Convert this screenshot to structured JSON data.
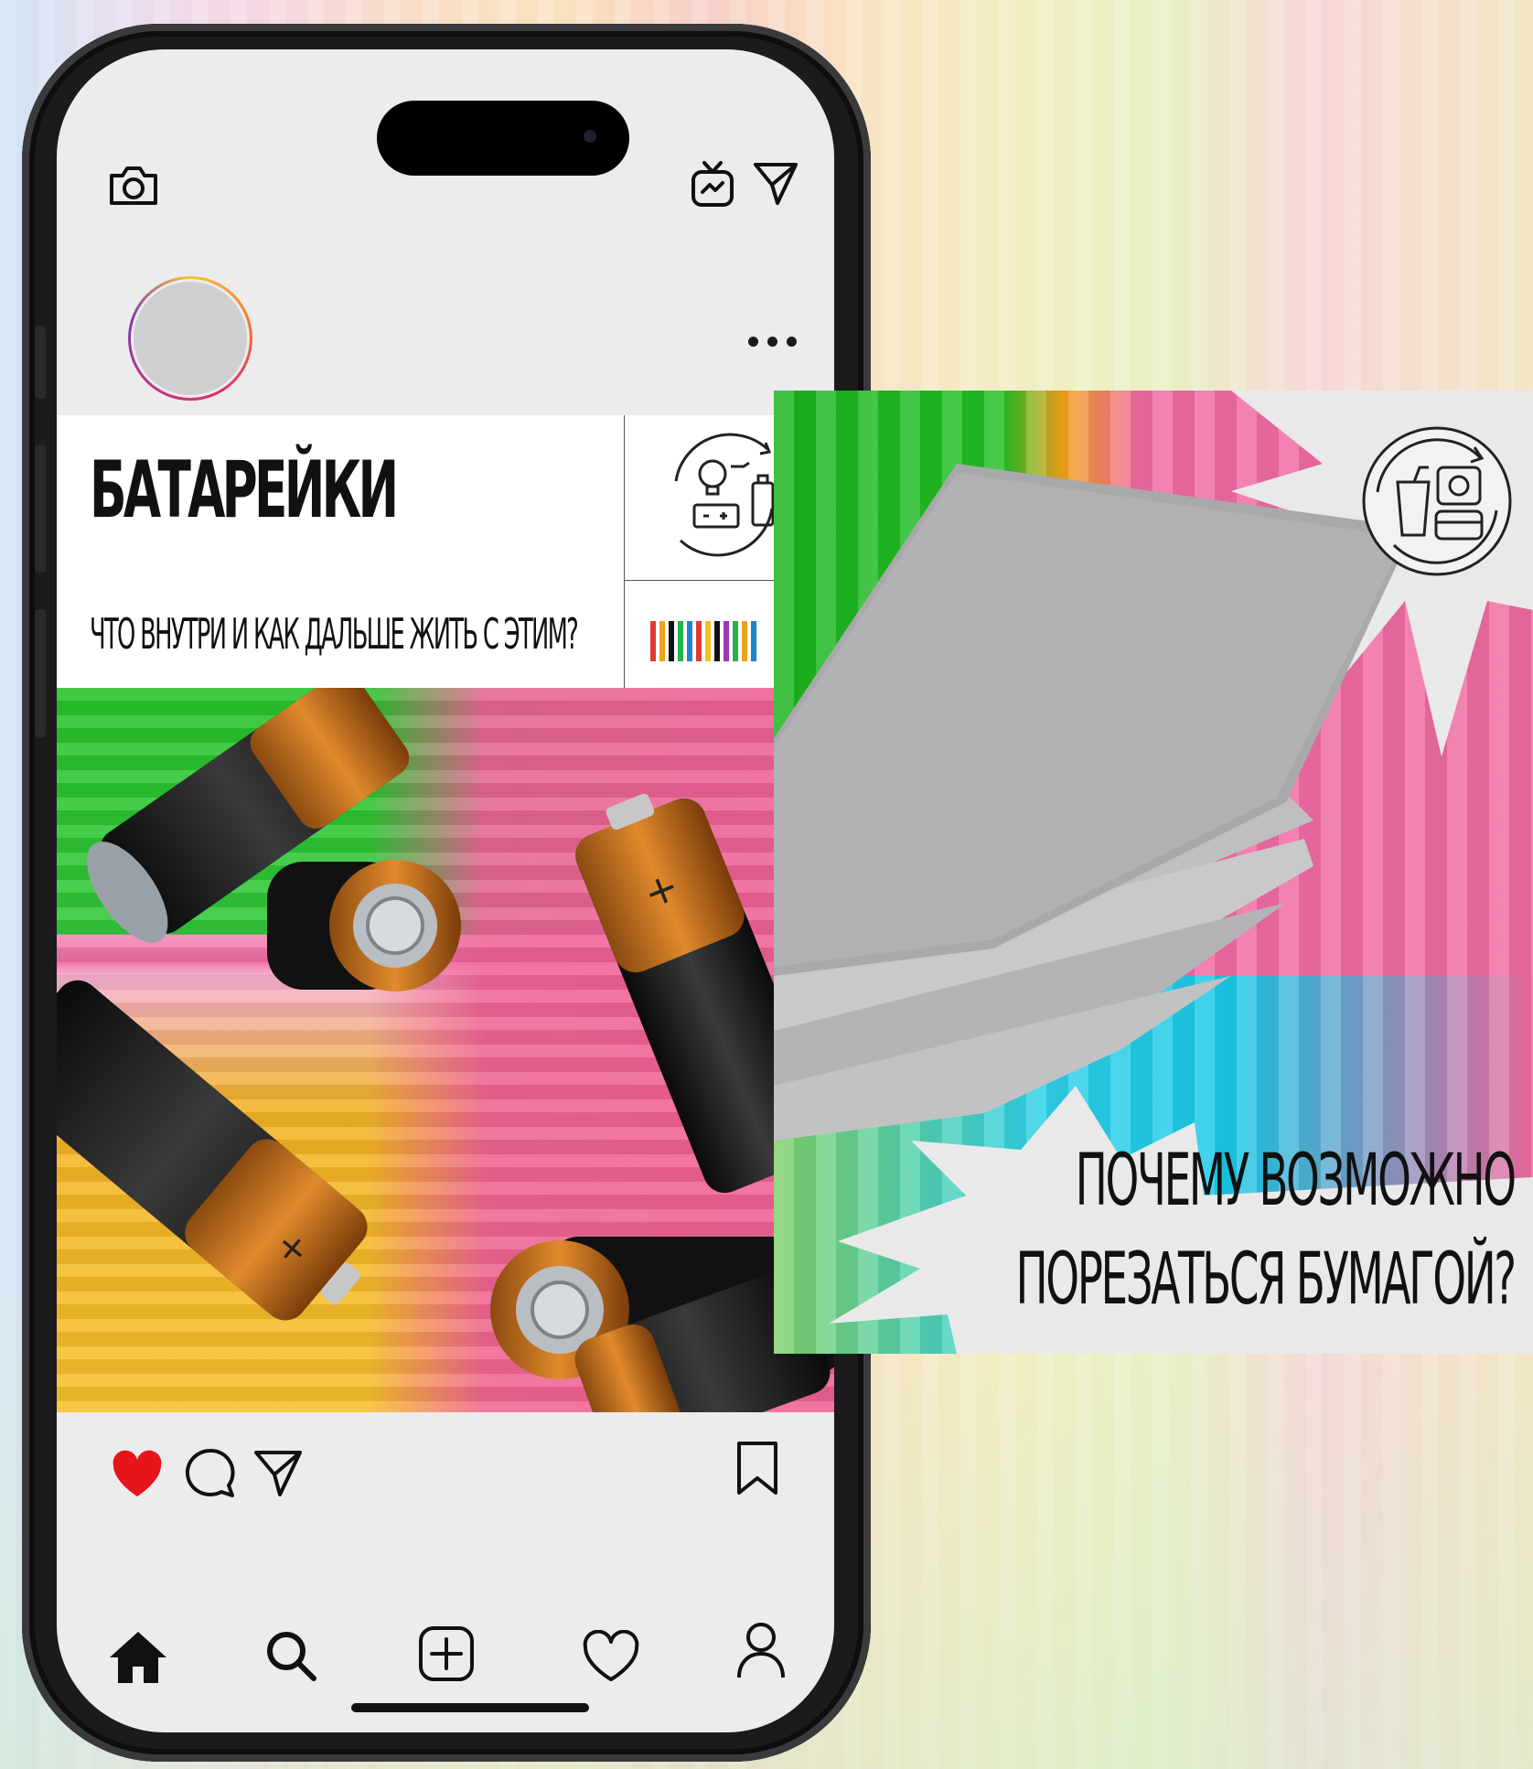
{
  "post": {
    "title": "БАТАРЕЙКИ",
    "subtitle": "ЧТО ВНУТРИ И КАК ДАЛЬШЕ ЖИТЬ С ЭТИМ?"
  },
  "overlay_card": {
    "headline_line1": "ПОЧЕМУ ВОЗМОЖНО",
    "headline_line2": "ПОРЕЗАТЬСЯ БУМАГОЙ?"
  },
  "icons": {
    "top_left": "camera-icon",
    "top_right": [
      "igtv-icon",
      "direct-message-icon"
    ],
    "post_more": "more-options-icon",
    "actions": [
      "like-heart-icon",
      "comment-icon",
      "share-icon",
      "bookmark-icon"
    ],
    "nav": [
      "home-icon",
      "search-icon",
      "add-post-icon",
      "activity-heart-icon",
      "profile-icon"
    ],
    "post_badge": "battery-recycle-icon",
    "card_badge": "waste-recycle-icon"
  },
  "colors": {
    "like": "#e8141b",
    "green": "#27c229",
    "pink": "#ef6ca1",
    "yellow": "#f7c02c",
    "cyan": "#19c9e8"
  }
}
